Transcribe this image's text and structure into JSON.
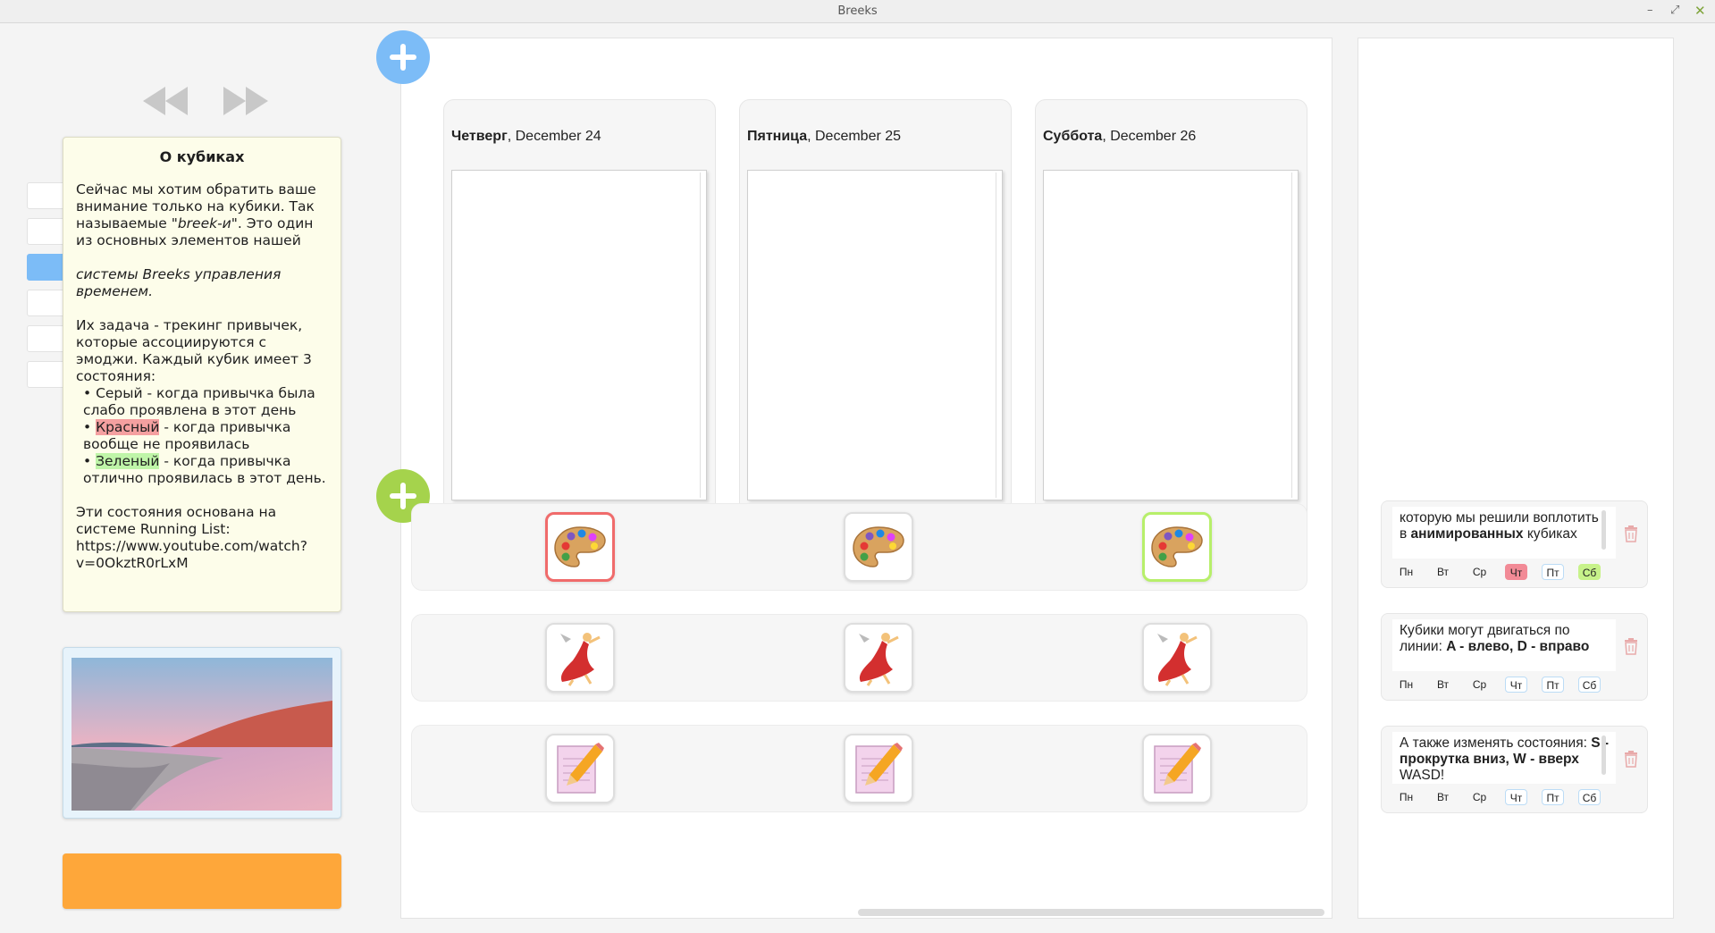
{
  "window": {
    "title": "Breeks",
    "minimize": "–",
    "restore": "⤢",
    "close": "✕"
  },
  "nav": {
    "prev_icon": "rewind-icon",
    "next_icon": "fast-forward-icon"
  },
  "note": {
    "title": "О кубиках",
    "p1": "Сейчас мы хотим обратить ваше внимание только на кубики. Так называемые ",
    "p1_em": "\"breek-и\"",
    "p1_end": ". Это один из основных элементов нашей",
    "p2": "системы Breeks управления временем.",
    "p3": "Их задача - трекинг привычек, которые ассоциируются с эмоджи. Каждый кубик имеет 3 состояния:",
    "b1": "• Серый - когда привычка была слабо проявлена в этот день",
    "b2_bullet": "• ",
    "b2_hl": "Красный",
    "b2_rest": " - когда привычка вообще не проявилась",
    "b3_bullet": "• ",
    "b3_hl": "Зеленый",
    "b3_rest": " - когда привычка отлично проявилась в этот день.",
    "p4": "Эти состояния основана на системе Running List: https://www.youtube.com/watch?v=0OkztR0rLxM"
  },
  "days": [
    {
      "weekday": "Четверг",
      "date": ", December 24"
    },
    {
      "weekday": "Пятница",
      "date": ", December 25"
    },
    {
      "weekday": "Суббота",
      "date": ", December 26"
    }
  ],
  "habit_rows": [
    {
      "emoji": "palette-icon",
      "states": [
        "red",
        "gray",
        "green"
      ]
    },
    {
      "emoji": "dancer-icon",
      "states": [
        "gray",
        "gray",
        "gray"
      ]
    },
    {
      "emoji": "memo-icon",
      "states": [
        "gray",
        "gray",
        "gray"
      ]
    }
  ],
  "habits": [
    {
      "line1": "которую мы решили воплотить в ",
      "bold": "анимированных",
      "line2": " кубиках",
      "days": [
        "Пн",
        "Вт",
        "Ср",
        "Чт",
        "Пт",
        "Сб"
      ],
      "states": [
        "plain",
        "plain",
        "plain",
        "red",
        "out",
        "green"
      ]
    },
    {
      "line1": "Кубики могут двигаться по линии: ",
      "bold": "A - влево, D - вправо",
      "line2": "",
      "days": [
        "Пн",
        "Вт",
        "Ср",
        "Чт",
        "Пт",
        "Сб"
      ],
      "states": [
        "plain",
        "plain",
        "plain",
        "out",
        "out",
        "out"
      ]
    },
    {
      "line1": "А также изменять состояния: ",
      "bold": "S - прокрутка вниз, W - вверх",
      "line2": " WASD!",
      "days": [
        "Пн",
        "Вт",
        "Ср",
        "Чт",
        "Пт",
        "Сб"
      ],
      "states": [
        "plain",
        "plain",
        "plain",
        "out",
        "out",
        "out"
      ]
    }
  ],
  "colors": {
    "accent_blue": "#7cbcf7",
    "accent_green": "#a5d34c",
    "orange": "#fea73a",
    "cube_red": "#f06b6b",
    "cube_green": "#b7ef6a"
  }
}
